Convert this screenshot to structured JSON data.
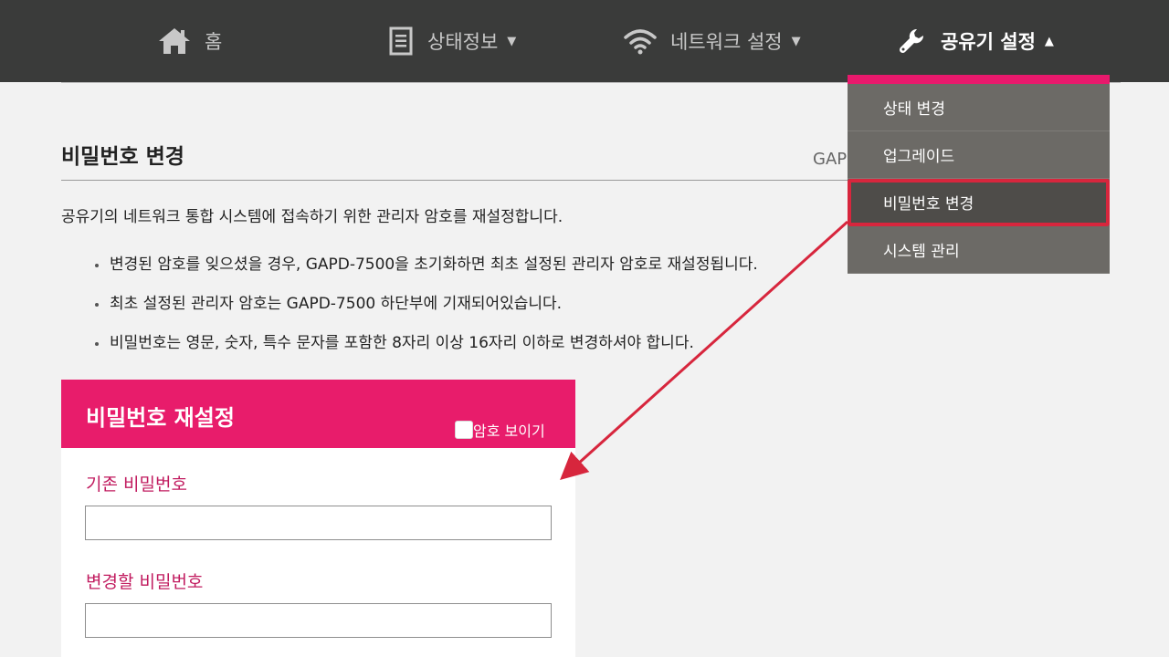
{
  "nav": {
    "home": "홈",
    "status": "상태정보",
    "network": "네트워크 설정",
    "router": "공유기 설정"
  },
  "dropdown": {
    "items": [
      {
        "label": "상태 변경"
      },
      {
        "label": "업그레이드"
      },
      {
        "label": "비밀번호 변경"
      },
      {
        "label": "시스템 관리"
      }
    ],
    "selected": "비밀번호 변경"
  },
  "page": {
    "title": "비밀번호 변경",
    "model": "GAPD",
    "description": "공유기의 네트워크 통합 시스템에 접속하기 위한 관리자 암호를 재설정합니다.",
    "bullets": [
      "변경된 암호를 잊으셨을 경우, GAPD-7500을 초기화하면 최초 설정된 관리자 암호로 재설정됩니다.",
      "최초 설정된 관리자 암호는 GAPD-7500 하단부에 기재되어있습니다.",
      "비밀번호는 영문, 숫자, 특수 문자를 포함한 8자리 이상 16자리 이하로 변경하셔야 합니다."
    ]
  },
  "panel": {
    "title": "비밀번호 재설정",
    "show_password": "암호 보이기",
    "current_label": "기존 비밀번호",
    "current_value": "",
    "new_label": "변경할 비밀번호",
    "new_value": ""
  },
  "colors": {
    "nav_bg": "#3a3b3a",
    "accent": "#e81c6b",
    "label": "#c11b5f",
    "dropdown_bg": "#6c6a66",
    "highlight": "#d7263d"
  }
}
